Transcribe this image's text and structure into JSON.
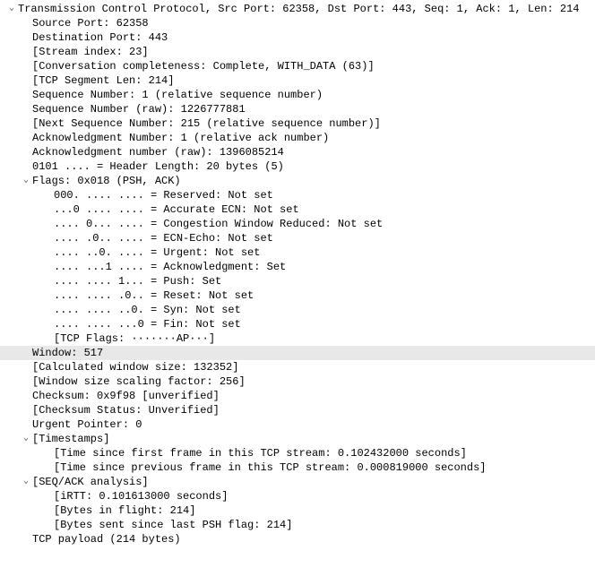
{
  "tcp": {
    "header": "Transmission Control Protocol, Src Port: 62358, Dst Port: 443, Seq: 1, Ack: 1, Len: 214",
    "src_port": "Source Port: 62358",
    "dst_port": "Destination Port: 443",
    "stream_index": "[Stream index: 23]",
    "conv_complete": "[Conversation completeness: Complete, WITH_DATA (63)]",
    "seg_len": "[TCP Segment Len: 214]",
    "seq_rel": "Sequence Number: 1    (relative sequence number)",
    "seq_raw": "Sequence Number (raw): 1226777881",
    "next_seq": "[Next Sequence Number: 215    (relative sequence number)]",
    "ack_rel": "Acknowledgment Number: 1    (relative ack number)",
    "ack_raw": "Acknowledgment number (raw): 1396085214",
    "hdr_len": "0101 .... = Header Length: 20 bytes (5)",
    "flags": {
      "summary": "Flags: 0x018 (PSH, ACK)",
      "reserved": "000. .... .... = Reserved: Not set",
      "aecn": "...0 .... .... = Accurate ECN: Not set",
      "cwr": ".... 0... .... = Congestion Window Reduced: Not set",
      "ecn": ".... .0.. .... = ECN-Echo: Not set",
      "urg": ".... ..0. .... = Urgent: Not set",
      "ack": ".... ...1 .... = Acknowledgment: Set",
      "psh": ".... .... 1... = Push: Set",
      "rst": ".... .... .0.. = Reset: Not set",
      "syn": ".... .... ..0. = Syn: Not set",
      "fin": ".... .... ...0 = Fin: Not set",
      "str": "[TCP Flags: ·······AP···]"
    },
    "window": "Window: 517",
    "calc_win": "[Calculated window size: 132352]",
    "win_scale": "[Window size scaling factor: 256]",
    "checksum": "Checksum: 0x9f98 [unverified]",
    "checksum_status": "[Checksum Status: Unverified]",
    "urgent_ptr": "Urgent Pointer: 0",
    "timestamps": {
      "summary": "[Timestamps]",
      "since_first": "[Time since first frame in this TCP stream: 0.102432000 seconds]",
      "since_prev": "[Time since previous frame in this TCP stream: 0.000819000 seconds]"
    },
    "seqack": {
      "summary": "[SEQ/ACK analysis]",
      "irtt": "[iRTT: 0.101613000 seconds]",
      "in_flight": "[Bytes in flight: 214]",
      "since_psh": "[Bytes sent since last PSH flag: 214]"
    },
    "payload": "TCP payload (214 bytes)"
  }
}
